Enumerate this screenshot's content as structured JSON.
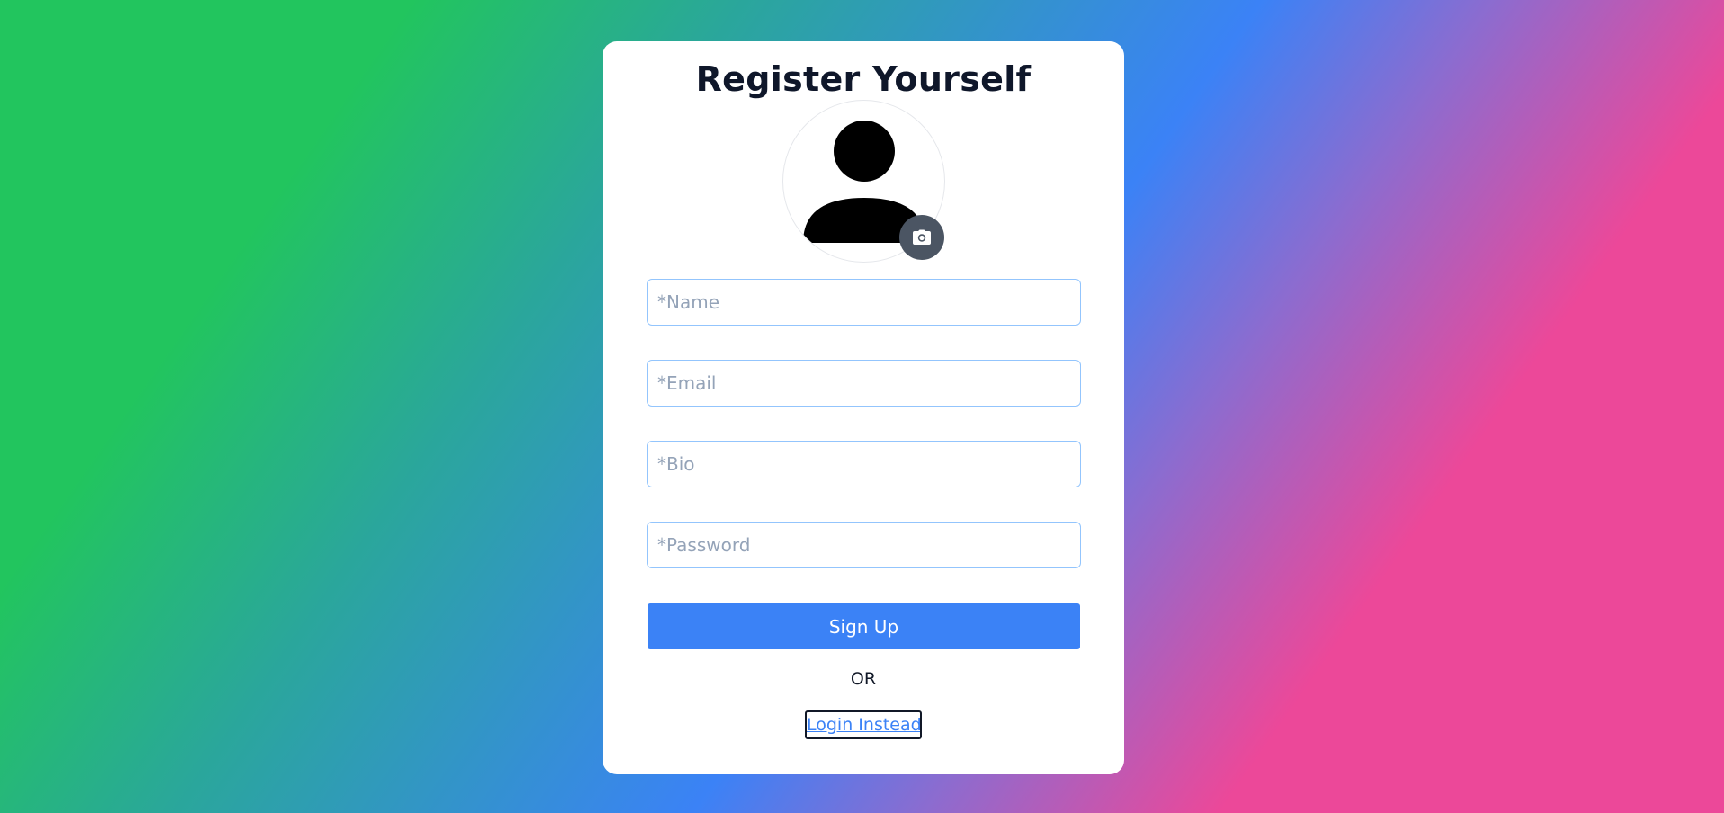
{
  "form": {
    "title": "Register Yourself",
    "avatar_icon": "user-silhouette-icon",
    "camera_icon": "camera-icon",
    "fields": {
      "name_placeholder": "*Name",
      "email_placeholder": "*Email",
      "bio_placeholder": "*Bio",
      "password_placeholder": "*Password"
    },
    "submit_label": "Sign Up",
    "separator": "OR",
    "login_link": "Login Instead"
  },
  "colors": {
    "accent": "#3b82f6",
    "camera_button": "#4b5563",
    "input_border": "#93c5fd",
    "gradient": [
      "#22c55e",
      "#3b82f6",
      "#ec4899"
    ]
  }
}
